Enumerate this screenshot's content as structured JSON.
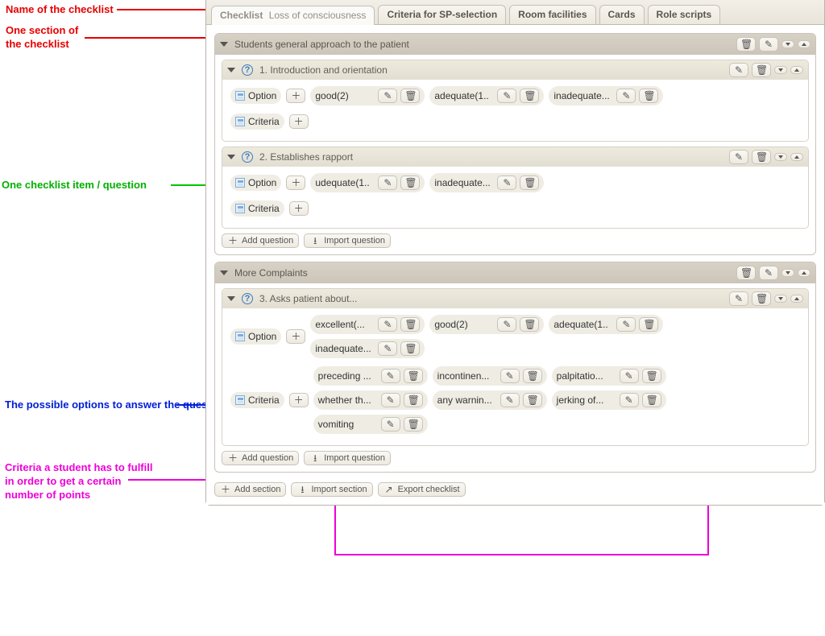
{
  "annotations": {
    "checklist_name": "Name of the checklist",
    "one_section": "One section of\nthe checklist",
    "one_item": "One checklist item / question",
    "options": "The possible options to answer\nthe question / checklist item",
    "criteria": "Criteria a student has to fulfill\nin order to get a certain\nnumber of points"
  },
  "tabs": {
    "active": {
      "prefix": "Checklist",
      "name": "Loss of consciousness"
    },
    "others": [
      "Criteria for SP-selection",
      "Room facilities",
      "Cards",
      "Role scripts"
    ]
  },
  "labels": {
    "option": "Option",
    "criteria": "Criteria",
    "add_question": "Add question",
    "import_question": "Import question",
    "add_section": "Add section",
    "import_section": "Import section",
    "export_checklist": "Export checklist"
  },
  "sections": [
    {
      "title": "Students general approach to the patient",
      "questions": [
        {
          "title": "1. Introduction and orientation",
          "options": [
            "good(2)",
            "adequate(1..",
            "inadequate..."
          ],
          "criteria": []
        },
        {
          "title": "2. Establishes rapport",
          "options": [
            "udequate(1..",
            "inadequate..."
          ],
          "criteria": []
        }
      ]
    },
    {
      "title": "More Complaints",
      "questions": [
        {
          "title": "3. Asks patient about...",
          "options": [
            "excellent(...",
            "good(2)",
            "adequate(1..",
            "inadequate..."
          ],
          "criteria": [
            "preceding ...",
            "incontinen...",
            "palpitatio...",
            "whether th...",
            "any warnin...",
            "jerking of...",
            "vomiting"
          ]
        }
      ]
    }
  ]
}
